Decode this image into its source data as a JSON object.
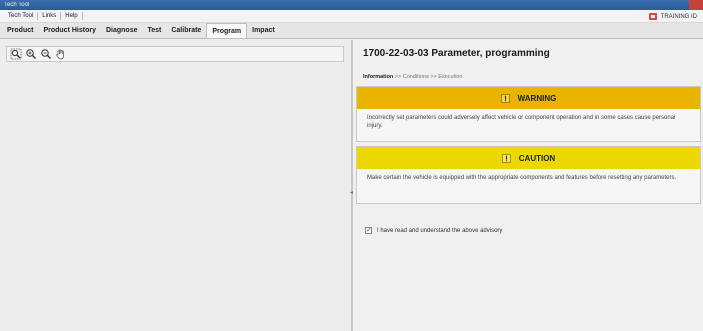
{
  "window": {
    "title": "Tech Tool"
  },
  "menu": {
    "items": [
      "Tech Tool",
      "Links",
      "Help"
    ]
  },
  "training": {
    "label": "TRAINING ID"
  },
  "tabs": [
    {
      "label": "Product"
    },
    {
      "label": "Product History"
    },
    {
      "label": "Diagnose"
    },
    {
      "label": "Test"
    },
    {
      "label": "Calibrate"
    },
    {
      "label": "Program",
      "active": true
    },
    {
      "label": "Impact"
    }
  ],
  "toolbar": {
    "icons": [
      "zoom-fit-icon",
      "zoom-in-icon",
      "zoom-out-icon",
      "pan-hand-icon"
    ]
  },
  "parameter": {
    "title": "1700-22-03-03 Parameter, programming",
    "breadcrumb": {
      "information": "Information",
      "sep1": ">>",
      "conditions": "Conditions",
      "sep2": ">>",
      "execution": "Execution"
    }
  },
  "warning": {
    "heading": "WARNING",
    "text": "Incorrectly set parameters could adversely affect vehicle or component operation and in some cases cause personal injury.",
    "color": "#e8b400"
  },
  "caution": {
    "heading": "CAUTION",
    "text": "Make certain the vehicle is equipped with the appropriate components and features before resetting any parameters.",
    "color": "#ecd800"
  },
  "acknowledge": {
    "label": "I have read and understand the above advisory",
    "checked": true
  }
}
